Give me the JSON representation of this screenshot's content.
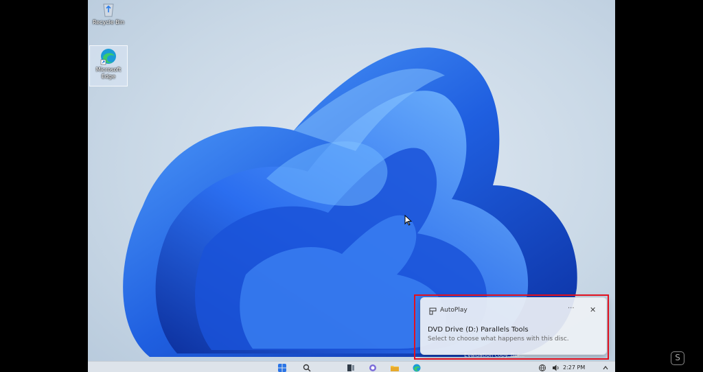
{
  "desktop": {
    "icons": [
      {
        "label": "Recycle Bin",
        "icon": "recycle-bin-icon"
      },
      {
        "label": "Microsoft Edge",
        "icon": "edge-icon"
      }
    ],
    "watermark": "Evaluation copy. Bui..."
  },
  "toast": {
    "app_name": "AutoPlay",
    "more_label": "···",
    "close_label": "✕",
    "title": "DVD Drive (D:) Parallels Tools",
    "body": "Select to choose what happens with this disc."
  },
  "taskbar": {
    "pinned": [
      "start-icon",
      "search-icon",
      "task-view-icon",
      "chat-icon",
      "file-explorer-icon",
      "edge-icon"
    ],
    "clock": "2:27 PM"
  },
  "colors": {
    "highlight": "#e3101e",
    "bloom": "#1f5fe0"
  }
}
